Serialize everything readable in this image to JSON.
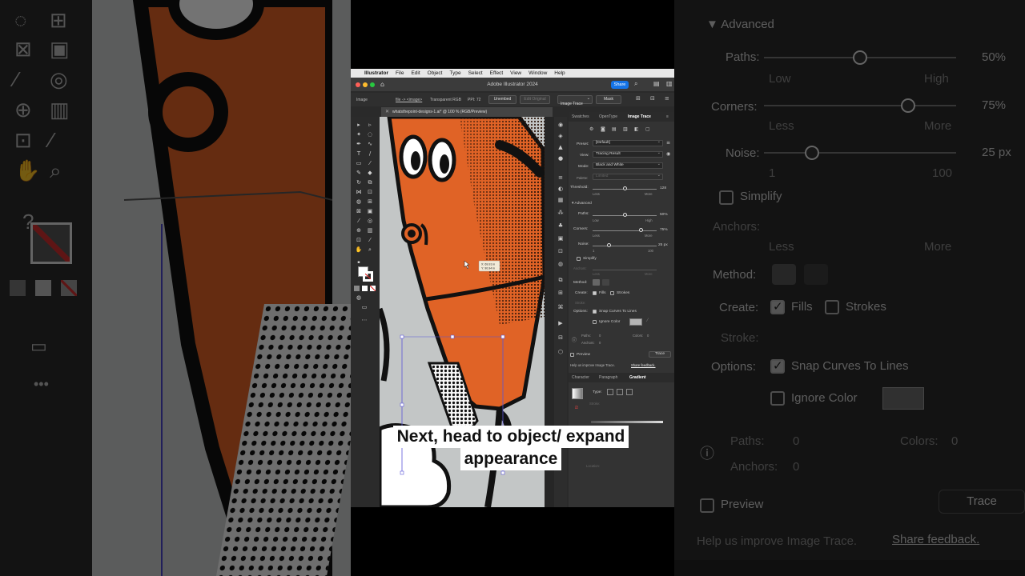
{
  "menubar": {
    "app_name": "Illustrator",
    "items": [
      "File",
      "Edit",
      "Object",
      "Type",
      "Select",
      "Effect",
      "View",
      "Window",
      "Help"
    ]
  },
  "titlebar": {
    "title": "Adobe Illustrator 2024",
    "share_label": "Share"
  },
  "control_bar": {
    "object_type": "Image",
    "link_info": "file -> <image>",
    "color_mode": "Transparent RGB",
    "ppi": "PPI: 72",
    "unembed_label": "Unembed",
    "edit_original_label": "Edit Original",
    "image_trace_label": "Image Trace",
    "mask_label": "Mask"
  },
  "document_tab": {
    "title": "whatsthepoint-designs-1.ai* @ 100 % (RGB/Preview)"
  },
  "canvas": {
    "coord_readout": "X: 69.91 in\nY: 90.94 in"
  },
  "panel_top_tabs": [
    "Swatches",
    "OpenType",
    "Image Trace"
  ],
  "image_trace": {
    "preset_label": "Preset:",
    "preset_value": "[Default]",
    "view_label": "View:",
    "view_value": "Tracing Result",
    "mode_label": "Mode:",
    "mode_value": "Black and White",
    "palette_label": "Palette:",
    "palette_value": "Limited",
    "threshold_label": "Threshold:",
    "threshold_value": "128",
    "threshold_level": 0.5,
    "less": "Less",
    "more": "More",
    "advanced_label": "Advanced",
    "paths_label": "Paths:",
    "paths_value": "50%",
    "paths_level": 0.5,
    "low": "Low",
    "high": "High",
    "corners_label": "Corners:",
    "corners_value": "75%",
    "corners_level": 0.75,
    "noise_label": "Noise:",
    "noise_value": "25 px",
    "noise_level": 0.25,
    "noise_min": "1",
    "noise_max": "100",
    "simplify_label": "Simplify",
    "anchors_label": "Anchors:",
    "method_label": "Method:",
    "create_label": "Create:",
    "fills_label": "Fills",
    "strokes_label": "Strokes",
    "stroke_label": "Stroke:",
    "options_label": "Options:",
    "snap_label": "Snap Curves To Lines",
    "ignore_color_label": "Ignore Color",
    "paths_count_label": "Paths:",
    "paths_count": "0",
    "colors_count_label": "Colors:",
    "colors_count": "0",
    "anchors_count_label": "Anchors:",
    "anchors_count": "0",
    "preview_label": "Preview",
    "trace_label": "Trace",
    "feedback_text": "Help us improve Image Trace.",
    "feedback_link": "Share feedback."
  },
  "panel_bottom_tabs": [
    "Character",
    "Paragraph",
    "Gradient"
  ],
  "gradient": {
    "type_label": "Type:",
    "stroke_label": "Stroke:",
    "location_label": "Location:"
  },
  "caption": {
    "line1": "Next, head to object/ expand",
    "line2": "appearance"
  },
  "colors": {
    "character_orange": "#e06326",
    "accent_blue": "#1473e6"
  }
}
